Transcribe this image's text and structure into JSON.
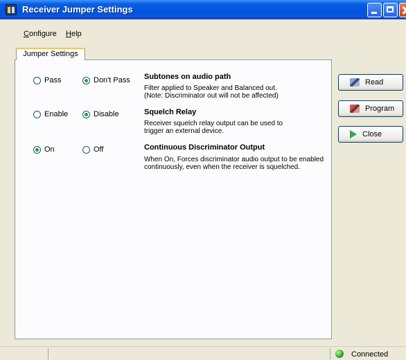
{
  "window": {
    "title": "Receiver Jumper Settings"
  },
  "menu": {
    "configure_u": "C",
    "configure_rest": "onfigure",
    "help_u": "H",
    "help_rest": "elp"
  },
  "tab": {
    "label": "Jumper Settings"
  },
  "options": [
    {
      "radio_a": {
        "label": "Pass",
        "checked": false
      },
      "radio_b": {
        "label": "Don't Pass",
        "checked": true
      },
      "title": "Subtones on audio path",
      "desc_1": "Filter applied to Speaker and Balanced out.",
      "desc_2": "(Note:  Discriminator out will not be affected)"
    },
    {
      "radio_a": {
        "label": "Enable",
        "checked": false
      },
      "radio_b": {
        "label": "Disable",
        "checked": true
      },
      "title": "Squelch Relay",
      "desc_1": "Receiver squelch relay output can be used to",
      "desc_2": "trigger an external device."
    },
    {
      "radio_a": {
        "label": "On",
        "checked": true
      },
      "radio_b": {
        "label": "Off",
        "checked": false
      },
      "title": "Continuous Discriminator Output",
      "desc_1": "When On, Forces discriminator audio output to be enabled",
      "desc_2": "continuously, even when the receiver is squelched."
    }
  ],
  "buttons": {
    "read": "Read",
    "program": "Program",
    "close": "Close"
  },
  "icons": {
    "app": "app-icon",
    "read": "read-icon",
    "program": "program-icon",
    "close": "close-arrow-icon",
    "status": "connected-status-icon"
  },
  "status": {
    "connection": "Connected"
  },
  "colors": {
    "titlebar": "#0054E3",
    "tab_highlight": "#FFC83C",
    "radio_dot": "#21A121",
    "status_ok": "#2FA12F"
  }
}
